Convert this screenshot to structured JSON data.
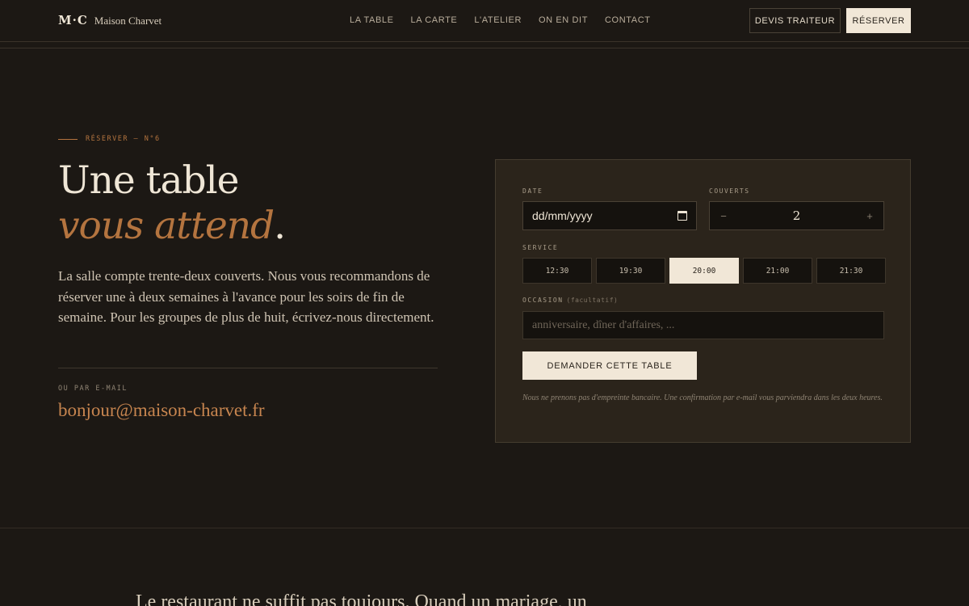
{
  "header": {
    "logo_mark": "M·C",
    "logo_name": "Maison Charvet",
    "nav": [
      "LA TABLE",
      "LA CARTE",
      "L'ATELIER",
      "ON EN DIT",
      "CONTACT"
    ],
    "quote_button": "DEVIS TRAITEUR",
    "reserve_button": "RÉSERVER"
  },
  "hero": {
    "eyebrow": "RÉSERVER — N°6",
    "title_line1": "Une table",
    "title_line2_italic": "vous attend",
    "title_line2_dot": ".",
    "lead": "La salle compte trente-deux couverts. Nous vous recommandons de réserver une à deux semaines à l'avance pour les soirs de fin de semaine. Pour les groupes de plus de huit, écrivez-nous directement.",
    "email_label": "OU PAR E-MAIL",
    "email": "bonjour@maison-charvet.fr"
  },
  "form": {
    "date_label": "DATE",
    "date_value": "dd/mm/yyyy",
    "covers_label": "COUVERTS",
    "covers_minus": "−",
    "covers_value": "2",
    "covers_plus": "+",
    "service_label": "SERVICE",
    "services": [
      "12:30",
      "19:30",
      "20:00",
      "21:00",
      "21:30"
    ],
    "selected_service": "20:00",
    "occasion_label": "OCCASION",
    "occasion_optional": "(facultatif)",
    "occasion_placeholder": "anniversaire, dîner d'affaires, ...",
    "submit_label": "DEMANDER CETTE TABLE",
    "note": "Nous ne prenons pas d'empreinte bancaire. Une confirmation par e-mail vous parviendra dans les deux heures."
  },
  "bottom": {
    "text": "Le restaurant ne suffit pas toujours. Quand un mariage, un"
  },
  "colors": {
    "background": "#1c1814",
    "accent": "#b4743f",
    "card": "#2b241b",
    "cream": "#f1e7d7"
  }
}
